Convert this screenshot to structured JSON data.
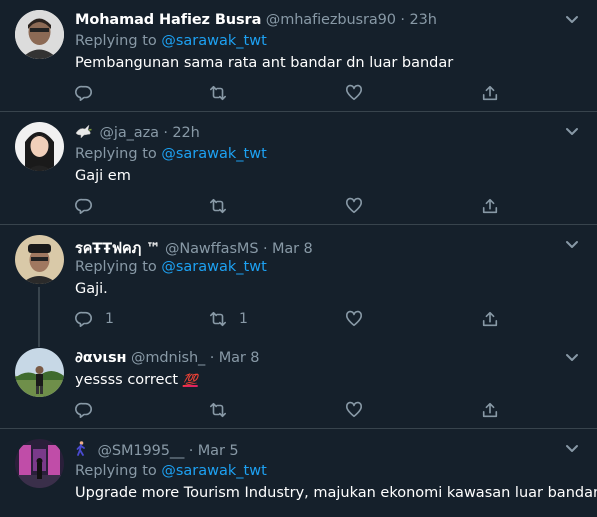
{
  "tweets": [
    {
      "name": "Mohamad Hafiez Busra",
      "handle": "@mhafiezbusra90",
      "time": "23h",
      "replying_prefix": "Replying to ",
      "replying_to": "@sarawak_twt",
      "text": "Pembangunan sama rata ant bandar dn luar bandar",
      "reply_count": "",
      "retweet_count": ""
    },
    {
      "name": "",
      "handle": "@ja_aza",
      "time": "22h",
      "replying_prefix": "Replying to ",
      "replying_to": "@sarawak_twt",
      "text": "Gaji em",
      "reply_count": "",
      "retweet_count": ""
    },
    {
      "name": "รคŦŦฟคฦ ™",
      "handle": "@NawffasMS",
      "time": "Mar 8",
      "replying_prefix": "Replying to ",
      "replying_to": "@sarawak_twt",
      "text": "Gaji.",
      "reply_count": "1",
      "retweet_count": "1"
    },
    {
      "name": "∂ανιѕн",
      "handle": "@mdnish_",
      "time": "Mar 8",
      "text": "yessss correct",
      "text_emoji": "💯",
      "reply_count": "",
      "retweet_count": ""
    },
    {
      "name": "",
      "handle": "@SM1995__",
      "time": "Mar 5",
      "replying_prefix": "Replying to ",
      "replying_to": "@sarawak_twt",
      "text": "Upgrade more Tourism Industry, majukan ekonomi kawasan luar bandar"
    }
  ],
  "separator": " · ",
  "colors": {
    "background": "#15202b",
    "border": "#38444d",
    "muted": "#8899a6",
    "accent": "#1da1f2",
    "text": "#ffffff"
  },
  "icons": [
    "reply-icon",
    "retweet-icon",
    "like-icon",
    "share-icon",
    "chevron-down-icon",
    "dove-icon",
    "walking-person-icon",
    "hundred-points-emoji"
  ]
}
